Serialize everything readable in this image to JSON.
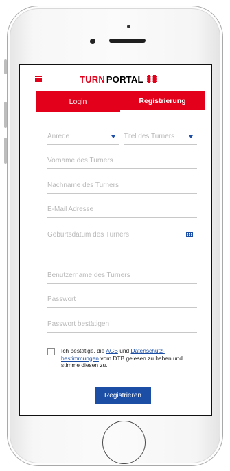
{
  "brand": {
    "turn": "TURN",
    "portal": "PORTAL"
  },
  "tabs": [
    {
      "label": "Login"
    },
    {
      "label": "Registrierung"
    }
  ],
  "form": {
    "anrede_placeholder": "Anrede",
    "titel_placeholder": "Titel des Turners",
    "vorname_placeholder": "Vorname des Turners",
    "nachname_placeholder": "Nachname des Turners",
    "email_placeholder": "E-Mail Adresse",
    "geburtsdatum_placeholder": "Geburtsdatum des Turners",
    "benutzername_placeholder": "Benutzername des Turners",
    "passwort_placeholder": "Passwort",
    "passwort_bestaetigen_placeholder": "Passwort bestätigen"
  },
  "consent": {
    "text_before": "Ich bestätige, die ",
    "agb_link": "AGB",
    "text_und": " und ",
    "datenschutz_link": "Datenschutz-bestimmungen",
    "text_after": " vom DTB gelesen zu haben und stimme diesen zu."
  },
  "submit_label": "Registrieren",
  "colors": {
    "brand_red": "#e2001a",
    "primary_blue": "#1c4ea5"
  },
  "icons": [
    "hamburger-menu-icon",
    "turnportal-logo-icon",
    "dropdown-caret-icon",
    "calendar-icon"
  ]
}
